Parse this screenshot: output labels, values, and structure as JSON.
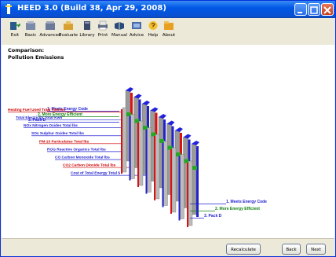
{
  "window": {
    "title": "HEED 3.0 (Build 38, Apr 29, 2008)"
  },
  "toolbar": {
    "items": [
      {
        "label": "Exit",
        "icon": "exit-icon"
      },
      {
        "label": "Basic",
        "icon": "basic-icon"
      },
      {
        "label": "Advanced",
        "icon": "advanced-icon"
      },
      {
        "label": "Evaluate",
        "icon": "evaluate-icon"
      },
      {
        "label": "Library",
        "icon": "library-icon"
      },
      {
        "label": "Print",
        "icon": "print-icon"
      },
      {
        "label": "Manual",
        "icon": "manual-icon"
      },
      {
        "label": "Advice",
        "icon": "advice-icon"
      },
      {
        "label": "Help",
        "icon": "help-icon"
      },
      {
        "label": "About",
        "icon": "about-icon"
      }
    ]
  },
  "content": {
    "heading1": "Comparison:",
    "heading2": "Pollution Emissions"
  },
  "chart_data": {
    "type": "bar",
    "style": "3d-grouped",
    "series": [
      {
        "name": "1. Meets Energy Code",
        "color": "#2020d0"
      },
      {
        "name": "2. More Energy Efficient",
        "color": "#108010"
      },
      {
        "name": "3. Pack D",
        "color": "#2020d0"
      }
    ],
    "left_series_labels": [
      "1. Meets Energy Code",
      "2. More Energy Efficient",
      "3. Pack D"
    ],
    "right_series_labels": [
      "1. Meets Energy Code",
      "2. More Energy Efficient",
      "3. Pack D"
    ],
    "categories": [
      "Heating Fuel Used   Total Therms",
      "Total Electricity    Total Kwh",
      "NOx Nitrogen Oxides    Total lbs",
      "SOx Sulphur Oxides    Total lbs",
      "PM-10 Particulates    Total lbs",
      "ROG Reactive Organics   Total lbs",
      "CO Carbon Monoxide    Total lbs",
      "CO2 Carbon Dioxide    Total lbs",
      "Cost of Total Energy    Total $"
    ],
    "category_colors": [
      "#cc0000",
      "#2020d0",
      "#2020d0",
      "#2020d0",
      "#cc0000",
      "#2020d0",
      "#2020d0",
      "#cc0000",
      "#2020d0"
    ],
    "colors": {
      "bar_front": "#9a9a9a",
      "red_side": "#dd1111",
      "blue_side": "#2222cc",
      "green_band": "#22aa22",
      "blue_top": "#2222dd"
    }
  },
  "buttons": {
    "recalculate": "Recalculate",
    "back": "Back",
    "next": "Next"
  }
}
